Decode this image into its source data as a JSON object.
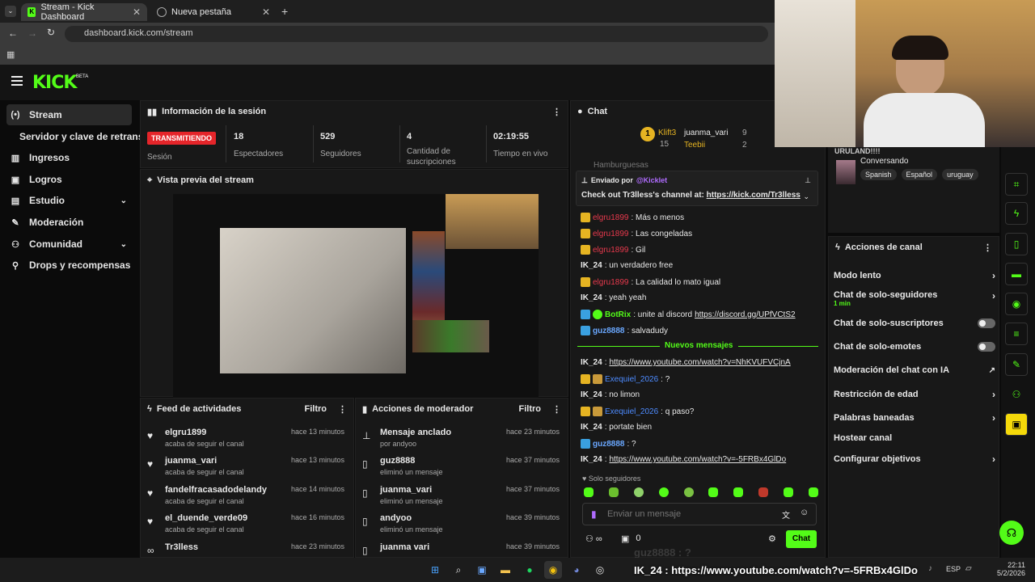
{
  "browser": {
    "tabs": [
      {
        "label": "Stream - Kick Dashboard"
      },
      {
        "label": "Nueva pestaña"
      }
    ],
    "url": "dashboard.kick.com/stream"
  },
  "brand": {
    "logo": "KICK",
    "beta": "BETA",
    "accent": "#53fc18"
  },
  "sidebar": {
    "items": [
      {
        "label": "Stream",
        "icon": "broadcast-icon"
      },
      {
        "label": "Servidor y clave de retransm",
        "icon": ""
      },
      {
        "label": "Ingresos",
        "icon": "bank-icon"
      },
      {
        "label": "Logros",
        "icon": "trophy-icon"
      },
      {
        "label": "Estudio",
        "icon": "studio-icon"
      },
      {
        "label": "Moderación",
        "icon": "wrench-icon"
      },
      {
        "label": "Comunidad",
        "icon": "community-icon"
      },
      {
        "label": "Drops y recompensas",
        "icon": "drops-icon"
      }
    ]
  },
  "session": {
    "title": "Información de la sesión",
    "status": "TRANSMITIENDO",
    "session_label": "Sesión",
    "stats": [
      {
        "value": "18",
        "label": "Espectadores"
      },
      {
        "value": "529",
        "label": "Seguidores"
      },
      {
        "value": "4",
        "label": "Cantidad de suscripciones"
      },
      {
        "value": "02:19:55",
        "label": "Tiempo en vivo"
      }
    ]
  },
  "preview": {
    "title": "Vista previa del stream"
  },
  "activity": {
    "title": "Feed de actividades",
    "filter": "Filtro",
    "items": [
      {
        "name": "elgru1899",
        "sub": "acaba de seguir el canal",
        "time": "hace 13 minutos"
      },
      {
        "name": "juanma_vari",
        "sub": "acaba de seguir el canal",
        "time": "hace 13 minutos"
      },
      {
        "name": "fandelfracasadodelandy",
        "sub": "acaba de seguir el canal",
        "time": "hace 14 minutos"
      },
      {
        "name": "el_duende_verde09",
        "sub": "acaba de seguir el canal",
        "time": "hace 16 minutos"
      },
      {
        "name": "Tr3lless",
        "sub": "",
        "time": "hace 23 minutos"
      }
    ]
  },
  "modactions": {
    "title": "Acciones de moderador",
    "filter": "Filtro",
    "items": [
      {
        "name": "Mensaje anclado",
        "sub": "por andyoo",
        "time": "hace 23 minutos"
      },
      {
        "name": "guz8888",
        "sub": "eliminó un mensaje",
        "time": "hace 37 minutos"
      },
      {
        "name": "juanma_vari",
        "sub": "eliminó un mensaje",
        "time": "hace 37 minutos"
      },
      {
        "name": "andyoo",
        "sub": "eliminó un mensaje",
        "time": "hace 39 minutos"
      },
      {
        "name": "juanma vari",
        "sub": "",
        "time": "hace 39 minutos"
      }
    ]
  },
  "chat": {
    "title": "Chat",
    "top_text": "Hamburguesas",
    "leaderboard": [
      {
        "name": "Klift3",
        "count": "9"
      },
      {
        "name": "juanma_vari",
        "count": "9"
      },
      {
        "count": "15"
      },
      {
        "name": "Teebii",
        "count": "2"
      }
    ],
    "pinned": {
      "by_label": "Enviado por",
      "by_user": "@Kicklet",
      "text": "Check out Tr3lless's channel at:",
      "link": "https://kick.com/Tr3lless"
    },
    "messages": [
      {
        "user": "elgru1899",
        "text": ": Más o menos"
      },
      {
        "user": "elgru1899",
        "text": ": Las congeladas"
      },
      {
        "user": "elgru1899",
        "text": ": Gil"
      },
      {
        "user": "IK_24",
        "text": ": un verdadero free"
      },
      {
        "user": "elgru1899",
        "text": ": La calidad lo mato igual"
      },
      {
        "user": "IK_24",
        "text": ": yeah yeah"
      },
      {
        "user": "BotRix",
        "text": ": unite al discord",
        "link": "https://discord.gg/UPfVCtS2"
      },
      {
        "user": "guz8888",
        "text": ": salvadudy"
      }
    ],
    "new_label": "Nuevos mensajes",
    "new_messages": [
      {
        "user": "IK_24",
        "text": ":",
        "link": "https://www.youtube.com/watch?v=NhKVUFVCjnA"
      },
      {
        "user": "Exequiel_2026",
        "text": ": ?"
      },
      {
        "user": "IK_24",
        "text": ": no limon"
      },
      {
        "user": "Exequiel_2026",
        "text": ": q paso?"
      },
      {
        "user": "IK_24",
        "text": ": portate bien"
      },
      {
        "user": "guz8888",
        "text": ": ?"
      },
      {
        "user": "IK_24",
        "text": ":",
        "link": "https://www.youtube.com/watch?v=-5FRBx4GlDo"
      }
    ],
    "mode_label": "Solo seguidores",
    "input_placeholder": "Enviar un mensaje",
    "send_label": "Chat",
    "bottom_count": "0"
  },
  "profile": {
    "status": "Conversando",
    "tags": [
      "Spanish",
      "Español",
      "uruguay"
    ],
    "top_text": "URULAND!!!!"
  },
  "channel_actions": {
    "title": "Acciones de canal",
    "items": [
      {
        "label": "Modo lento",
        "kind": "chevron"
      },
      {
        "label": "Chat de solo-seguidores",
        "sub": "1 min",
        "kind": "chevron"
      },
      {
        "label": "Chat de solo-suscriptores",
        "kind": "toggle"
      },
      {
        "label": "Chat de solo-emotes",
        "kind": "toggle"
      },
      {
        "label": "Moderación del chat con IA",
        "kind": "external"
      },
      {
        "label": "Restricción de edad",
        "kind": "chevron"
      },
      {
        "label": "Palabras baneadas",
        "kind": "chevron"
      },
      {
        "label": "Hostear canal",
        "kind": "none"
      },
      {
        "label": "Configurar objetivos",
        "kind": "chevron"
      }
    ]
  },
  "overlay_text": "IK_24 : https://www.youtube.com/watch?v=-5FRBx4GlDo",
  "overlay_faded": "guz8888 : ?",
  "taskbar": {
    "lang": "ESP",
    "time": "22:11",
    "date": "5/2/2026"
  }
}
